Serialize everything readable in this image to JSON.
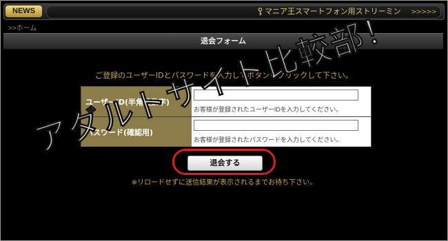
{
  "topbar": {
    "news_label": "NEWS",
    "ticker_text": "マニア王スマートフォン用ストリーミン",
    "ticker_arrows": ">>>>>"
  },
  "breadcrumb": {
    "home": ">>ホーム"
  },
  "form": {
    "title": "退会フォーム",
    "instructions": "ご登録のユーザーIDとパスワードを入力してボタンをクリックして下さい。",
    "fields": [
      {
        "label": "ユーザーID(半角英数字)",
        "value": "",
        "hint": "お客様が登録されたユーザーIDを入力してください。"
      },
      {
        "label": "パスワード(確認用)",
        "value": "",
        "hint": "お客様が登録されたパスワードを入力してください。"
      }
    ],
    "submit_label": "退会する",
    "note": "※リロードせずに送信結果が表示されるまでお待ち下さい。"
  },
  "watermark": "アダルトサイト比較部！",
  "colors": {
    "accent_gold": "#c9a54a",
    "label_bg": "#8c7c4a",
    "highlight_ring": "#e21b1b"
  },
  "icons": {
    "ticker_key": "key-icon"
  }
}
